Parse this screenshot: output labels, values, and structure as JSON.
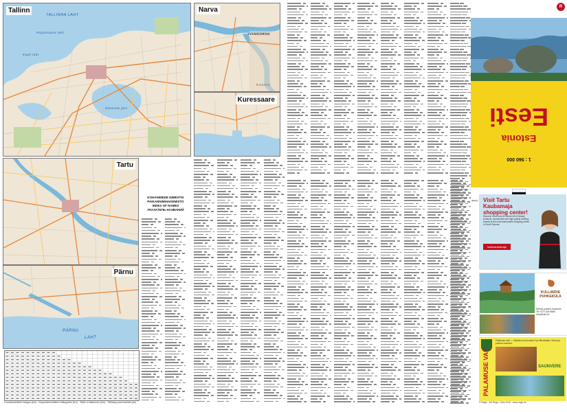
{
  "maps": {
    "tallinn": {
      "title": "Tallinn",
      "places": [
        "TALLINNA  LAHT",
        "Paljassaare laht",
        "Kopli laht",
        "Ülemiste järv"
      ]
    },
    "narva": {
      "title": "Narva",
      "places": [
        "IVANGOROD",
        "RUSSIA"
      ]
    },
    "kuressaare": {
      "title": "Kuressaare"
    },
    "tartu": {
      "title": "Tartu"
    },
    "parnu": {
      "title": "Pärnu",
      "places": [
        "PÄRNU",
        "LAHT"
      ]
    }
  },
  "index": {
    "heading": [
      "KOHANIMEDE NIMESTIK",
      "PAIKANNIMIHAKEMISTO",
      "INDEX OF NAMES",
      "УКАЗАТЕЛЬ НАЗВАНИЙ"
    ],
    "letter": "A"
  },
  "distance": {
    "caption": "Linnadevaheline kaugus (km)  ·  Kaupunkienvälinen etäisyyden (km)  ·  Table of distances (km)  ·  Таблица расстояний (км)"
  },
  "cover": {
    "title": "Eesti",
    "subtitle": "Estonia",
    "scale": "1 : 560 000",
    "strip_lines": [
      "Teekaart  ·  Tiekartta  ·  Карта автодорог",
      "Road map  ·  Maantiekartta  ·  Straßenkarte"
    ],
    "strip_scale": "1 : 560 000",
    "strip_brand": "Eesti"
  },
  "ads": {
    "tartu_kaubamaja": {
      "title": "Visit Tartu Kaubamaja shopping center!",
      "body": "Discover more than 60 stores full of beauty products, accessories and high-quality clothing brands at the most fashionable shopping center in South Estonia.",
      "logo": "tartukaubamaja"
    },
    "kulli": {
      "title": "KULLIÄRVE PUHKEKÜLA",
      "body": "Mõnus puhkus looduses. Tel +372 526 8866 info@kulli.ee"
    },
    "palamuse": {
      "vertical": "PALAMUSE VALD",
      "brand": "SAUNVERE",
      "body": "Palamuse vald — Kiirpilkuul ka kevadel 5 ja Ülikoolipäev. Sauna ja puhkus looduses."
    },
    "publisher": "© Regio  ·  AS Regio, Tartu 2019  ·  www.regio.ee"
  },
  "colors": {
    "brand_red": "#c0111f",
    "cover_yellow": "#f5d21a",
    "water": "#a9d2ea",
    "road": "#e8883a"
  }
}
